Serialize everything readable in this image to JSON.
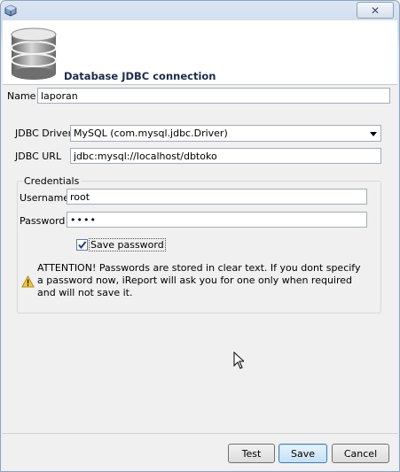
{
  "window": {
    "close_symbol": "✕",
    "icon": "app-cube-icon"
  },
  "header": {
    "title": "Database JDBC connection",
    "icon": "database-icon"
  },
  "form": {
    "name_label": "Name",
    "name_value": "laporan",
    "driver_label": "JDBC Driver",
    "driver_value": "MySQL (com.mysql.jdbc.Driver)",
    "url_label": "JDBC URL",
    "url_value": "jdbc:mysql://localhost/dbtoko"
  },
  "credentials": {
    "title": "Credentials",
    "username_label": "Username",
    "username_value": "root",
    "password_label": "Password",
    "password_value": "••••",
    "save_password_label": "Save password",
    "save_password_checked": true,
    "warning_text": "ATTENTION! Passwords are stored in clear text. If you dont specify a password now, iReport will ask you for one only when required and will not save it.",
    "warning_icon": "warning-icon"
  },
  "buttons": {
    "test": "Test",
    "save": "Save",
    "cancel": "Cancel"
  }
}
